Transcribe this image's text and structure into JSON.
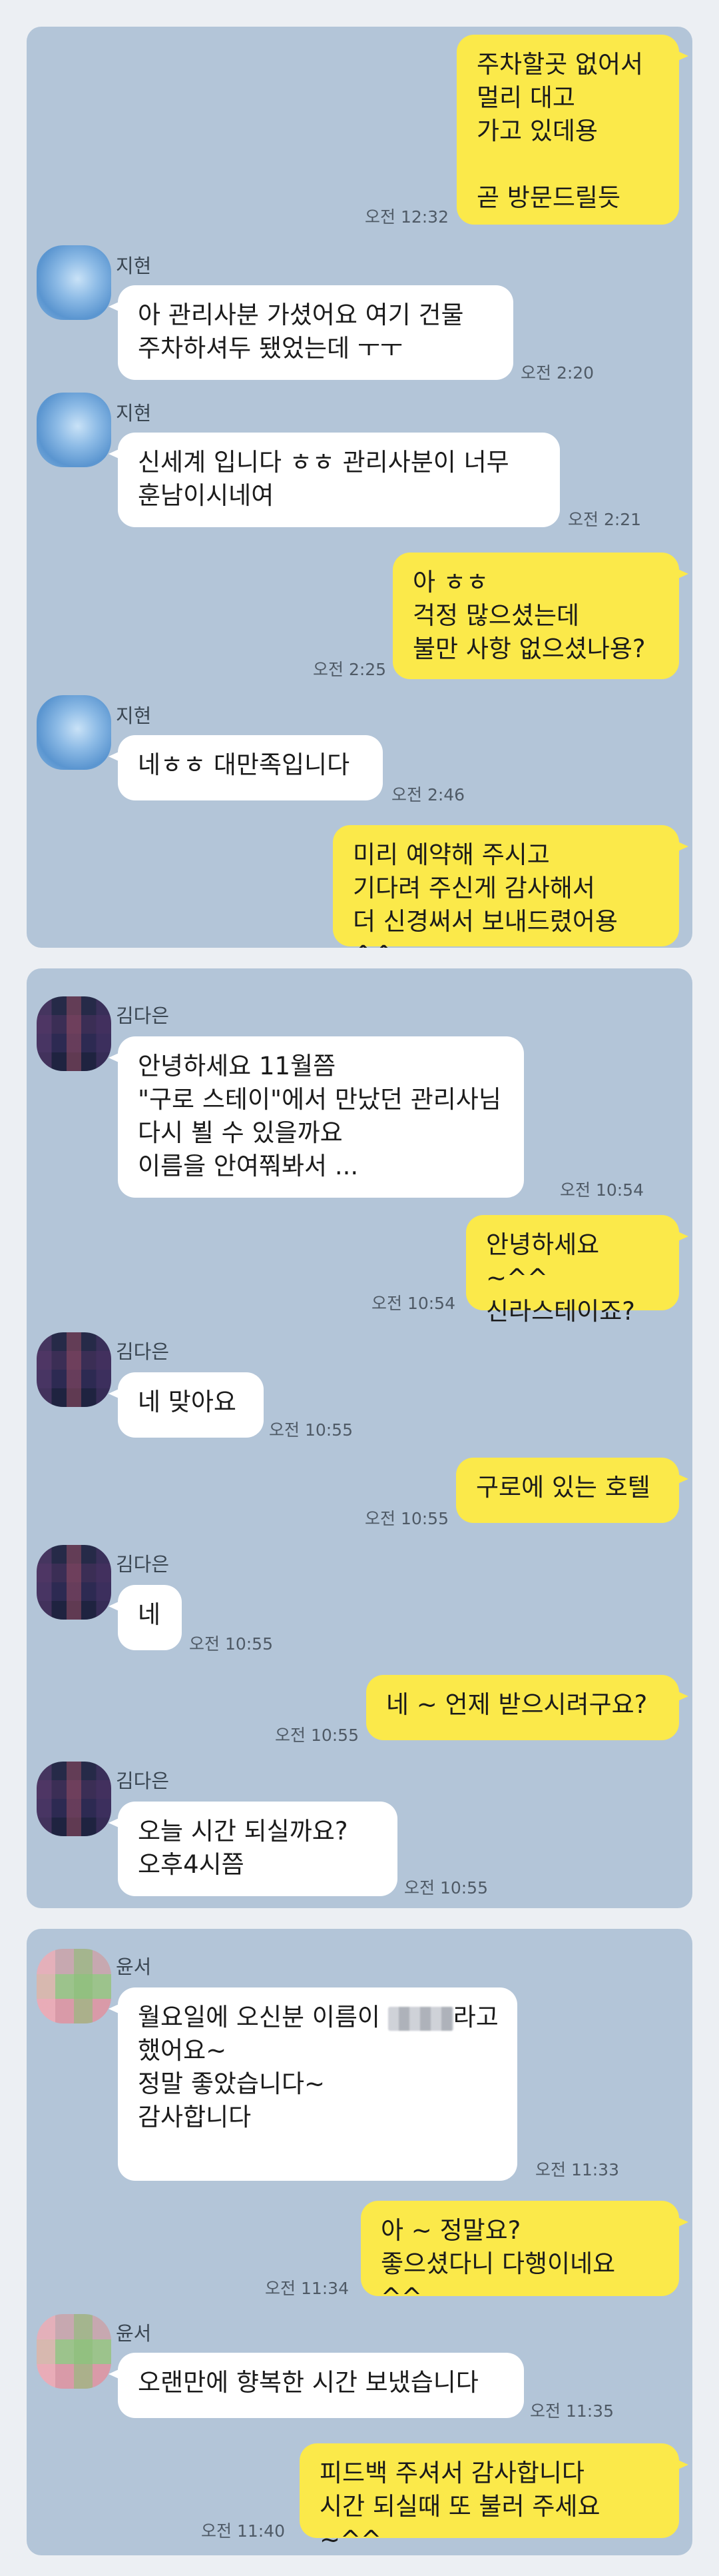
{
  "panel1": {
    "m1": {
      "text": "주차할곳 없어서\n멀리 대고\n가고 있데용\n\n곧 방문드릴듯",
      "time": "오전 12:32"
    },
    "m2": {
      "name": "지현",
      "text": "아 관리사분 가셨어요 여기 건물\n주차하셔두 됐었는데 ㅜㅜ",
      "time": "오전 2:20"
    },
    "m3": {
      "name": "지현",
      "text": "신세계 입니다 ㅎㅎ 관리사분이 너무\n훈남이시네여",
      "time": "오전 2:21"
    },
    "m4": {
      "text": "아 ㅎㅎ\n걱정 많으셨는데\n불만 사항 없으셨나용?",
      "time": "오전 2:25"
    },
    "m5": {
      "name": "지현",
      "text": "네ㅎㅎ 대만족입니다",
      "time": "오전 2:46"
    },
    "m6": {
      "text": "미리 예약해 주시고\n기다려 주신게 감사해서\n더 신경써서 보내드렸어용 ^^"
    }
  },
  "panel2": {
    "m1": {
      "name": "김다은",
      "text": "안녕하세요 11월쯤\n\"구로 스테이\"에서 만났던 관리사님\n다시 뵐 수 있을까요\n이름을 안여쭤봐서 ...",
      "time": "오전 10:54"
    },
    "m2": {
      "text": "안녕하세요 ~^^\n신라스테이죠?",
      "time": "오전 10:54"
    },
    "m3": {
      "name": "김다은",
      "text": "네 맞아요",
      "time": "오전 10:55"
    },
    "m4": {
      "text": "구로에 있는 호텔",
      "time": "오전 10:55"
    },
    "m5": {
      "name": "김다은",
      "text": "네",
      "time": "오전 10:55"
    },
    "m6": {
      "text": "네 ~ 언제 받으시려구요?",
      "time": "오전 10:55"
    },
    "m7": {
      "name": "김다은",
      "text": "오늘  시간 되실까요?\n오후4시쯤",
      "time": "오전 10:55"
    }
  },
  "panel3": {
    "m1": {
      "name": "윤서",
      "line1_pre": "월요일에 오신분 이름이 ",
      "line1_post": "라고",
      "rest": "했어요~\n정말 좋았습니다~\n감사합니다",
      "time": "오전 11:33"
    },
    "m2": {
      "text": "아 ~ 정말요?\n좋으셨다니 다행이네요 ^^",
      "time": "오전 11:34"
    },
    "m3": {
      "name": "윤서",
      "text": "오랜만에 향복한 시간 보냈습니다",
      "time": "오전 11:35"
    },
    "m4": {
      "text": "피드백 주셔서 감사합니다\n시간 되실때 또 불러 주세요 ~^^",
      "time": "오전 11:40"
    }
  }
}
